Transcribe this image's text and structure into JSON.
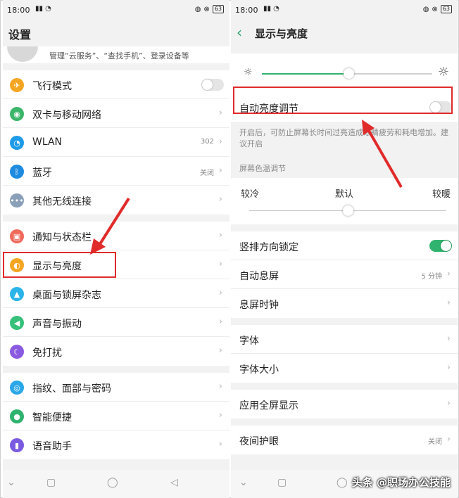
{
  "left": {
    "status": {
      "time": "18:00",
      "signal": "₄₆",
      "battery": "63"
    },
    "title": "设置",
    "account_subtitle": "管理“云服务”、“查找手机”、登录设备等",
    "groups": [
      [
        {
          "label": "飞行模式",
          "icon": "airplane-icon",
          "color": "#f4a623",
          "glyph": "✈",
          "type": "toggle"
        },
        {
          "label": "双卡与移动网络",
          "icon": "globe-icon",
          "color": "#3cb66a",
          "glyph": "◉",
          "type": "chevron"
        },
        {
          "label": "WLAN",
          "icon": "wifi-icon",
          "color": "#1e9be8",
          "glyph": "◔",
          "type": "chevron",
          "value": "302"
        },
        {
          "label": "蓝牙",
          "icon": "bluetooth-icon",
          "color": "#1e8be0",
          "glyph": "ᛒ",
          "type": "chevron",
          "value": "关闭"
        },
        {
          "label": "其他无线连接",
          "icon": "more-icon",
          "color": "#8aa0b8",
          "glyph": "•••",
          "type": "chevron"
        }
      ],
      [
        {
          "label": "通知与状态栏",
          "icon": "notification-icon",
          "color": "#f06a5c",
          "glyph": "▣",
          "type": "chevron"
        },
        {
          "label": "显示与亮度",
          "icon": "brightness-icon",
          "color": "#f4a623",
          "glyph": "◐",
          "type": "chevron"
        },
        {
          "label": "桌面与锁屏杂志",
          "icon": "wallpaper-icon",
          "color": "#2ab4e8",
          "glyph": "▲",
          "type": "chevron"
        },
        {
          "label": "声音与振动",
          "icon": "speaker-icon",
          "color": "#36c07a",
          "glyph": "◀",
          "type": "chevron"
        },
        {
          "label": "免打扰",
          "icon": "moon-icon",
          "color": "#8a5ae0",
          "glyph": "☾",
          "type": "chevron"
        }
      ],
      [
        {
          "label": "指纹、面部与密码",
          "icon": "fingerprint-icon",
          "color": "#2aa7e8",
          "glyph": "◎",
          "type": "chevron"
        },
        {
          "label": "智能便捷",
          "icon": "smart-icon",
          "color": "#2fb36e",
          "glyph": "●",
          "type": "chevron"
        },
        {
          "label": "语音助手",
          "icon": "microphone-icon",
          "color": "#7a5ae0",
          "glyph": "▮",
          "type": "chevron"
        }
      ]
    ]
  },
  "right": {
    "status": {
      "time": "18:00",
      "signal": "₄₆",
      "battery": "63"
    },
    "title": "显示与亮度",
    "brightness_level": 0.51,
    "auto_brightness_label": "自动亮度调节",
    "auto_brightness_hint": "开启后，可防止屏幕长时间过亮造成眼睛疲劳和耗电增加。建议开启",
    "color_temp_title": "屏幕色温调节",
    "color_temp_labels": {
      "cool": "较冷",
      "default": "默认",
      "warm": "较暖"
    },
    "color_temp_level": 0.5,
    "groups": [
      [
        {
          "label": "竖排方向锁定",
          "type": "toggle-on"
        },
        {
          "label": "自动息屏",
          "type": "chevron",
          "value": "5 分钟"
        },
        {
          "label": "息屏时钟",
          "type": "chevron"
        }
      ],
      [
        {
          "label": "字体",
          "type": "chevron"
        },
        {
          "label": "字体大小",
          "type": "chevron"
        }
      ],
      [
        {
          "label": "应用全屏显示",
          "type": "chevron"
        }
      ],
      [
        {
          "label": "夜间护眼",
          "type": "chevron",
          "value": "关闭"
        }
      ]
    ]
  },
  "watermark": "头条 @职场办公技能",
  "colors": {
    "accent": "#2fb36e",
    "highlight": "#e12b2b"
  }
}
